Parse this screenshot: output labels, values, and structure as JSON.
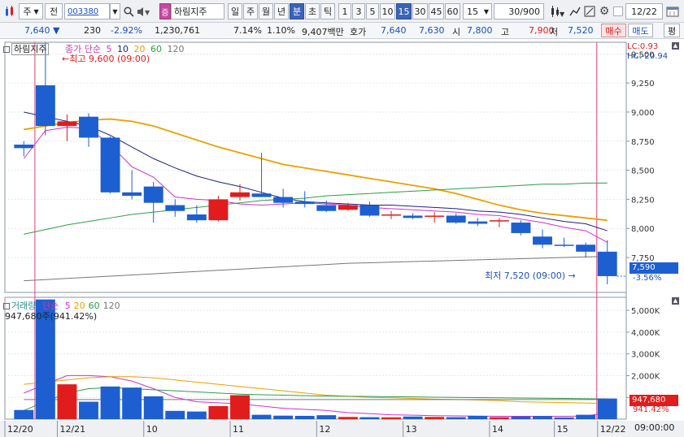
{
  "toolbar": {
    "market_select": "주",
    "view_select": "전",
    "code": "003380",
    "stock_badge": "증",
    "stock_name": "하림지주",
    "period_tabs": [
      {
        "label": "일",
        "active": false
      },
      {
        "label": "주",
        "active": false
      },
      {
        "label": "월",
        "active": false
      },
      {
        "label": "년",
        "active": false
      },
      {
        "label": "분",
        "active": true
      },
      {
        "label": "초",
        "active": false
      },
      {
        "label": "틱",
        "active": false
      }
    ],
    "minute_tabs": [
      {
        "label": "1",
        "active": false
      },
      {
        "label": "3",
        "active": false
      },
      {
        "label": "5",
        "active": false
      },
      {
        "label": "10",
        "active": false
      },
      {
        "label": "15",
        "active": true
      },
      {
        "label": "30",
        "active": false
      },
      {
        "label": "45",
        "active": false
      },
      {
        "label": "60",
        "active": false
      }
    ],
    "interval_value": "15",
    "count_value": "30/900",
    "date_value": "12/22"
  },
  "quote": {
    "price": "7,640",
    "change": "230",
    "change_pct": "-2.92%",
    "volume": "1,230,761",
    "vol_rate": "7.14%",
    "turnover": "1.10%",
    "amount": "9,407백만",
    "bid_label": "호가",
    "ask_price": "7,640",
    "bid_price": "7,630",
    "open_label": "시",
    "open": "7,800",
    "high_label": "고",
    "high": "7,900",
    "low_label": "저",
    "low": "7,520",
    "buy_label": "매수",
    "sell_label": "매도",
    "eval_label": "평"
  },
  "price_panel": {
    "name_tag": "하림지주",
    "legend_title": "종가 단순",
    "ma_labels": [
      "5",
      "10",
      "20",
      "60",
      "120"
    ],
    "ma_colors": [
      "#cc33cc",
      "#1a237e",
      "#e8a200",
      "#2e9c4a",
      "#777777"
    ],
    "high_annotation": "최고 9,600 (09:00)",
    "low_annotation": "최저 7,520 (09:00)",
    "lc_text": "LC:0.93",
    "hc_text": "HC:-20.94",
    "current_price_tag": "7,590",
    "current_pct_tag": "-3.56%"
  },
  "volume_panel": {
    "legend_title": "거래량",
    "legend_ma": "단순",
    "ma_labels": [
      "5",
      "20",
      "60",
      "120"
    ],
    "ma_colors": [
      "#cc33cc",
      "#e8a200",
      "#2e9c4a",
      "#777777"
    ],
    "volume_readout": "947,680주(941.42%)",
    "current_volume_tag": "947,680",
    "current_vol_pct_tag": "941.42%"
  },
  "x_axis": {
    "labels": [
      "12/20",
      "12/21",
      "10",
      "11",
      "12",
      "13",
      "14",
      "15",
      "12/22"
    ],
    "time_label": "09:00:00"
  },
  "colors": {
    "up": "#e01c1c",
    "down": "#1d5fd1",
    "accent": "#3a63b8"
  },
  "chart_data": {
    "type": "candlestick",
    "price_axis": {
      "ticks": [
        "9,500",
        "9,250",
        "9,000",
        "8,750",
        "8,500",
        "8,250",
        "8,000",
        "7,750"
      ],
      "range": [
        7450,
        9600
      ]
    },
    "volume_axis": {
      "ticks": [
        "5,000K",
        "4,000K",
        "3,000K",
        "2,000K",
        "1,000K"
      ],
      "range": [
        0,
        5600000
      ]
    },
    "candles": [
      {
        "o": 8720,
        "h": 8750,
        "l": 8620,
        "c": 8690,
        "v": 420000
      },
      {
        "o": 9230,
        "h": 9600,
        "l": 8800,
        "c": 8880,
        "v": 5500000
      },
      {
        "o": 8880,
        "h": 8980,
        "l": 8750,
        "c": 8920,
        "v": 1600000
      },
      {
        "o": 8960,
        "h": 8990,
        "l": 8700,
        "c": 8780,
        "v": 800000
      },
      {
        "o": 8780,
        "h": 8790,
        "l": 8300,
        "c": 8310,
        "v": 1500000
      },
      {
        "o": 8310,
        "h": 8500,
        "l": 8250,
        "c": 8280,
        "v": 1450000
      },
      {
        "o": 8360,
        "h": 8400,
        "l": 8050,
        "c": 8220,
        "v": 1050000
      },
      {
        "o": 8200,
        "h": 8250,
        "l": 8100,
        "c": 8150,
        "v": 380000
      },
      {
        "o": 8120,
        "h": 8200,
        "l": 8050,
        "c": 8070,
        "v": 350000
      },
      {
        "o": 8070,
        "h": 8280,
        "l": 8060,
        "c": 8250,
        "v": 600000
      },
      {
        "o": 8270,
        "h": 8380,
        "l": 8240,
        "c": 8310,
        "v": 1100000
      },
      {
        "o": 8300,
        "h": 8650,
        "l": 8270,
        "c": 8270,
        "v": 200000
      },
      {
        "o": 8270,
        "h": 8340,
        "l": 8180,
        "c": 8220,
        "v": 160000
      },
      {
        "o": 8230,
        "h": 8320,
        "l": 8180,
        "c": 8210,
        "v": 150000
      },
      {
        "o": 8200,
        "h": 8240,
        "l": 8140,
        "c": 8150,
        "v": 180000
      },
      {
        "o": 8160,
        "h": 8220,
        "l": 8150,
        "c": 8200,
        "v": 100000
      },
      {
        "o": 8200,
        "h": 8230,
        "l": 8100,
        "c": 8110,
        "v": 90000
      },
      {
        "o": 8110,
        "h": 8150,
        "l": 8080,
        "c": 8120,
        "v": 80000
      },
      {
        "o": 8110,
        "h": 8130,
        "l": 8080,
        "c": 8090,
        "v": 120000
      },
      {
        "o": 8100,
        "h": 8140,
        "l": 8050,
        "c": 8110,
        "v": 100000
      },
      {
        "o": 8110,
        "h": 8130,
        "l": 8040,
        "c": 8050,
        "v": 90000
      },
      {
        "o": 8060,
        "h": 8090,
        "l": 8020,
        "c": 8040,
        "v": 150000
      },
      {
        "o": 8060,
        "h": 8090,
        "l": 8010,
        "c": 8070,
        "v": 90000
      },
      {
        "o": 8050,
        "h": 8070,
        "l": 7940,
        "c": 7960,
        "v": 120000
      },
      {
        "o": 7930,
        "h": 7990,
        "l": 7830,
        "c": 7860,
        "v": 140000
      },
      {
        "o": 7860,
        "h": 7920,
        "l": 7840,
        "c": 7850,
        "v": 80000
      },
      {
        "o": 7860,
        "h": 7880,
        "l": 7750,
        "c": 7800,
        "v": 200000
      },
      {
        "o": 7800,
        "h": 7900,
        "l": 7520,
        "c": 7590,
        "v": 947680
      }
    ],
    "series": [
      {
        "name": "5",
        "values": [
          8600,
          8840,
          8870,
          8860,
          8720,
          8530,
          8440,
          8270,
          8250,
          8240,
          8210,
          8200,
          8210,
          8220,
          8210,
          8200,
          8180,
          8170,
          8160,
          8150,
          8140,
          8120,
          8110,
          8080,
          8050,
          8010,
          7980,
          7880
        ]
      },
      {
        "name": "10",
        "values": [
          9000,
          8960,
          8920,
          8880,
          8800,
          8700,
          8600,
          8520,
          8450,
          8400,
          8360,
          8310,
          8260,
          8230,
          8220,
          8210,
          8200,
          8200,
          8190,
          8180,
          8170,
          8150,
          8140,
          8120,
          8090,
          8060,
          8040,
          7980
        ]
      },
      {
        "name": "20",
        "values": [
          8850,
          8880,
          8910,
          8930,
          8940,
          8920,
          8880,
          8820,
          8760,
          8700,
          8650,
          8600,
          8550,
          8520,
          8490,
          8460,
          8430,
          8400,
          8370,
          8340,
          8300,
          8250,
          8200,
          8160,
          8130,
          8110,
          8090,
          8070
        ]
      },
      {
        "name": "60",
        "values": [
          7950,
          7990,
          8030,
          8060,
          8090,
          8120,
          8140,
          8160,
          8180,
          8200,
          8220,
          8240,
          8250,
          8260,
          8280,
          8290,
          8300,
          8310,
          8320,
          8330,
          8340,
          8350,
          8360,
          8370,
          8380,
          8380,
          8390,
          8390
        ]
      },
      {
        "name": "120",
        "values": [
          7550,
          7560,
          7570,
          7580,
          7590,
          7600,
          7610,
          7620,
          7630,
          7640,
          7650,
          7660,
          7670,
          7680,
          7690,
          7700,
          7705,
          7710,
          7715,
          7720,
          7725,
          7730,
          7735,
          7740,
          7745,
          7750,
          7755,
          7760
        ]
      }
    ],
    "volume_ma": [
      {
        "name": "5",
        "values": [
          1200000,
          1600000,
          2000000,
          2000000,
          1950000,
          1750000,
          1400000,
          1000000,
          800000,
          750000,
          700000,
          600000,
          500000,
          450000,
          400000,
          300000,
          250000,
          200000,
          180000,
          160000,
          150000,
          140000,
          130000,
          130000,
          130000,
          130000,
          140000,
          300000
        ]
      },
      {
        "name": "20",
        "values": [
          1600000,
          1700000,
          1800000,
          1900000,
          1950000,
          1950000,
          1900000,
          1800000,
          1700000,
          1600000,
          1500000,
          1400000,
          1300000,
          1200000,
          1100000,
          1050000,
          1000000,
          980000,
          950000,
          920000,
          900000,
          880000,
          850000,
          800000,
          780000,
          760000,
          740000,
          720000
        ]
      },
      {
        "name": "60",
        "values": [
          400000,
          800000,
          1200000,
          1400000,
          1450000,
          1400000,
          1350000,
          1300000,
          1250000,
          1200000,
          1150000,
          1120000,
          1100000,
          1080000,
          1060000,
          1050000,
          1040000,
          1030000,
          1020000,
          1010000,
          1000000,
          990000,
          980000,
          970000,
          960000,
          950000,
          940000,
          930000
        ]
      },
      {
        "name": "120",
        "values": [
          900000,
          900000,
          900000,
          900000,
          900000,
          900000,
          900000,
          900000,
          900000,
          900000,
          900000,
          900000,
          900000,
          900000,
          900000,
          900000,
          900000,
          900000,
          900000,
          900000,
          900000,
          900000,
          900000,
          900000,
          900000,
          900000,
          900000,
          900000
        ]
      }
    ]
  }
}
